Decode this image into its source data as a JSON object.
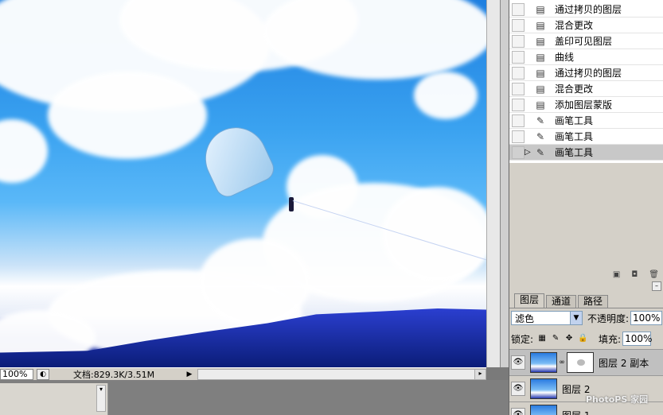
{
  "history": {
    "items": [
      {
        "label": "通过拷贝的图层",
        "icon": "document-icon"
      },
      {
        "label": "混合更改",
        "icon": "document-icon"
      },
      {
        "label": "盖印可见图层",
        "icon": "document-icon"
      },
      {
        "label": "曲线",
        "icon": "document-icon"
      },
      {
        "label": "通过拷贝的图层",
        "icon": "document-icon"
      },
      {
        "label": "混合更改",
        "icon": "document-icon"
      },
      {
        "label": "添加图层蒙版",
        "icon": "document-icon"
      },
      {
        "label": "画笔工具",
        "icon": "brush-icon"
      },
      {
        "label": "画笔工具",
        "icon": "brush-icon"
      },
      {
        "label": "画笔工具",
        "icon": "brush-icon",
        "selected": true
      }
    ]
  },
  "status": {
    "zoom": "100%",
    "doc_info": "文档:829.3K/3.51M"
  },
  "layers_panel": {
    "tabs": [
      "图层",
      "通道",
      "路径"
    ],
    "blend_mode": "滤色",
    "opacity_label": "不透明度:",
    "opacity_value": "100%",
    "lock_label": "锁定:",
    "fill_label": "填充:",
    "fill_value": "100%",
    "layers": [
      {
        "name": "图层 2 副本",
        "has_mask": true,
        "selected": true
      },
      {
        "name": "图层 2",
        "has_mask": false
      },
      {
        "name": "图层 1",
        "has_mask": false
      }
    ]
  },
  "watermark": "PhotoPS 家园"
}
